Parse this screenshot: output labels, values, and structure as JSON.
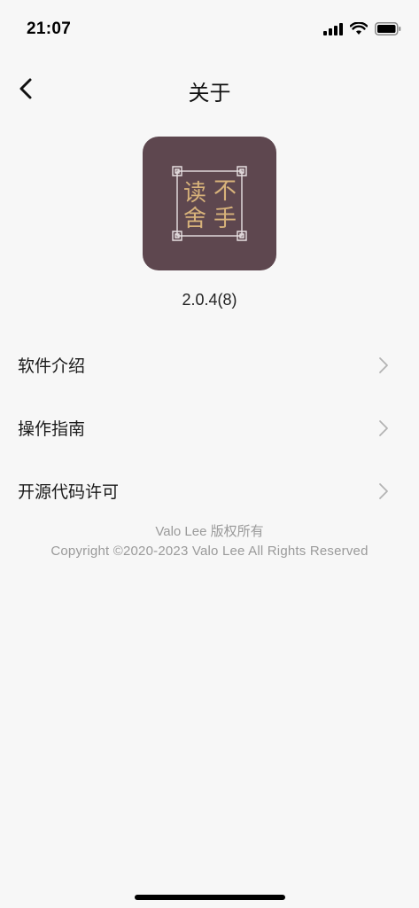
{
  "status_bar": {
    "time": "21:07",
    "icons": [
      "signal-icon",
      "wifi-icon",
      "battery-icon"
    ]
  },
  "nav": {
    "title": "关于",
    "back_icon": "chevron-left-icon"
  },
  "app": {
    "logo_chars": [
      "读",
      "不",
      "舍",
      "手"
    ],
    "version": "2.0.4(8)",
    "icon_bg": "#5e474f",
    "logo_color": "#d7b27a"
  },
  "menu": {
    "items": [
      {
        "label": "软件介绍"
      },
      {
        "label": "操作指南"
      },
      {
        "label": "开源代码许可"
      }
    ]
  },
  "footer": {
    "line1": "Valo Lee 版权所有",
    "line2": "Copyright ©2020-2023 Valo Lee All Rights Reserved"
  }
}
